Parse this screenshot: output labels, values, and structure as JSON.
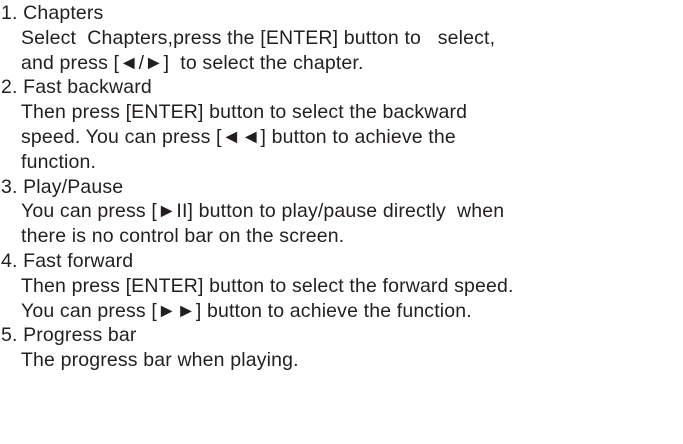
{
  "items": [
    {
      "title": "1. Chapters",
      "lines": [
        "Select  Chapters,press the [ENTER] button to   select,",
        "and press [◄/►]  to select the chapter."
      ]
    },
    {
      "title": "2. Fast backward",
      "lines": [
        "Then press [ENTER] button to select the backward",
        "speed. You can press [◄◄] button to achieve the",
        "function."
      ]
    },
    {
      "title": "3. Play/Pause",
      "lines": [
        "You can press [►II] button to play/pause directly  when",
        "there is no control bar on the screen."
      ]
    },
    {
      "title": "4. Fast forward",
      "lines": [
        "Then press [ENTER] button to select the forward speed.",
        "You can press [►►] button to achieve the function."
      ]
    },
    {
      "title": "5. Progress bar",
      "lines": [
        "The progress bar when playing."
      ]
    }
  ]
}
